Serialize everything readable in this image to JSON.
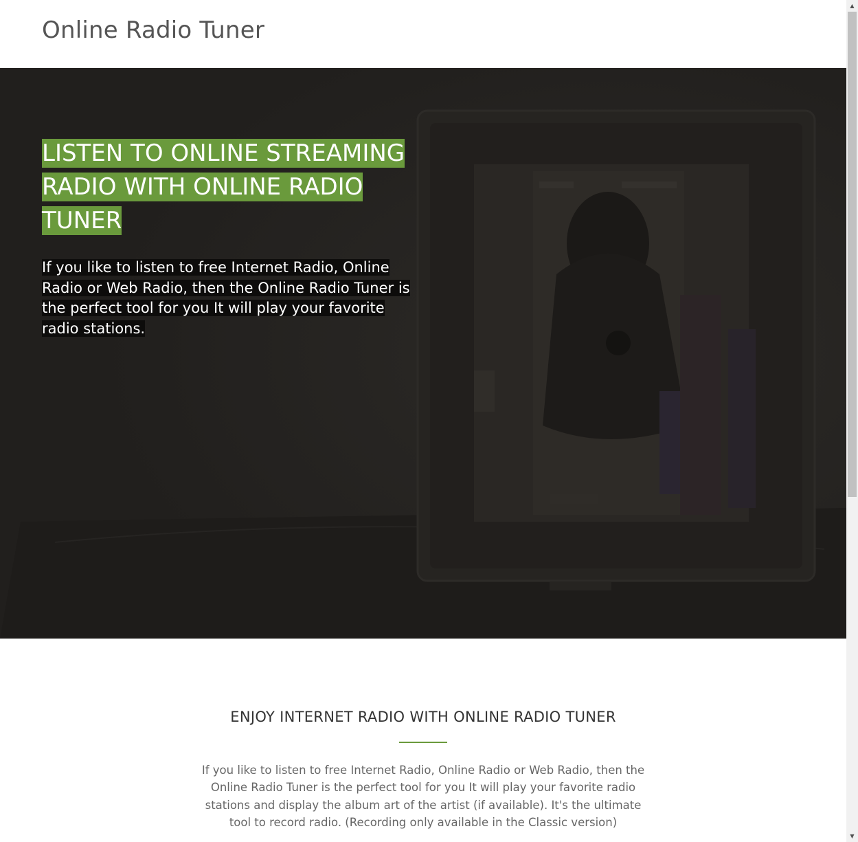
{
  "header": {
    "site_title": "Online Radio Tuner"
  },
  "hero": {
    "heading": "Listen to online streaming radio with Online Radio Tuner",
    "text": " If you like to listen to free Internet Radio, Online Radio or Web Radio, then the Online Radio Tuner is the perfect tool for you It will play your favorite radio stations. "
  },
  "intro": {
    "heading": "ENJOY INTERNET RADIO WITH ONLINE RADIO TUNER",
    "text": "If you like to listen to free Internet Radio, Online Radio or Web Radio, then the Online Radio Tuner is the perfect tool for you It will play your favorite radio stations and display the album art of the artist (if available). It's the ultimate tool to record radio. (Recording only available in the Classic version)"
  },
  "colors": {
    "accent": "#6a9a3c",
    "hero_background": "#211f1d"
  },
  "scrollbar": {
    "up_icon": "scroll-up-arrow-icon",
    "down_icon": "scroll-down-arrow-icon"
  }
}
